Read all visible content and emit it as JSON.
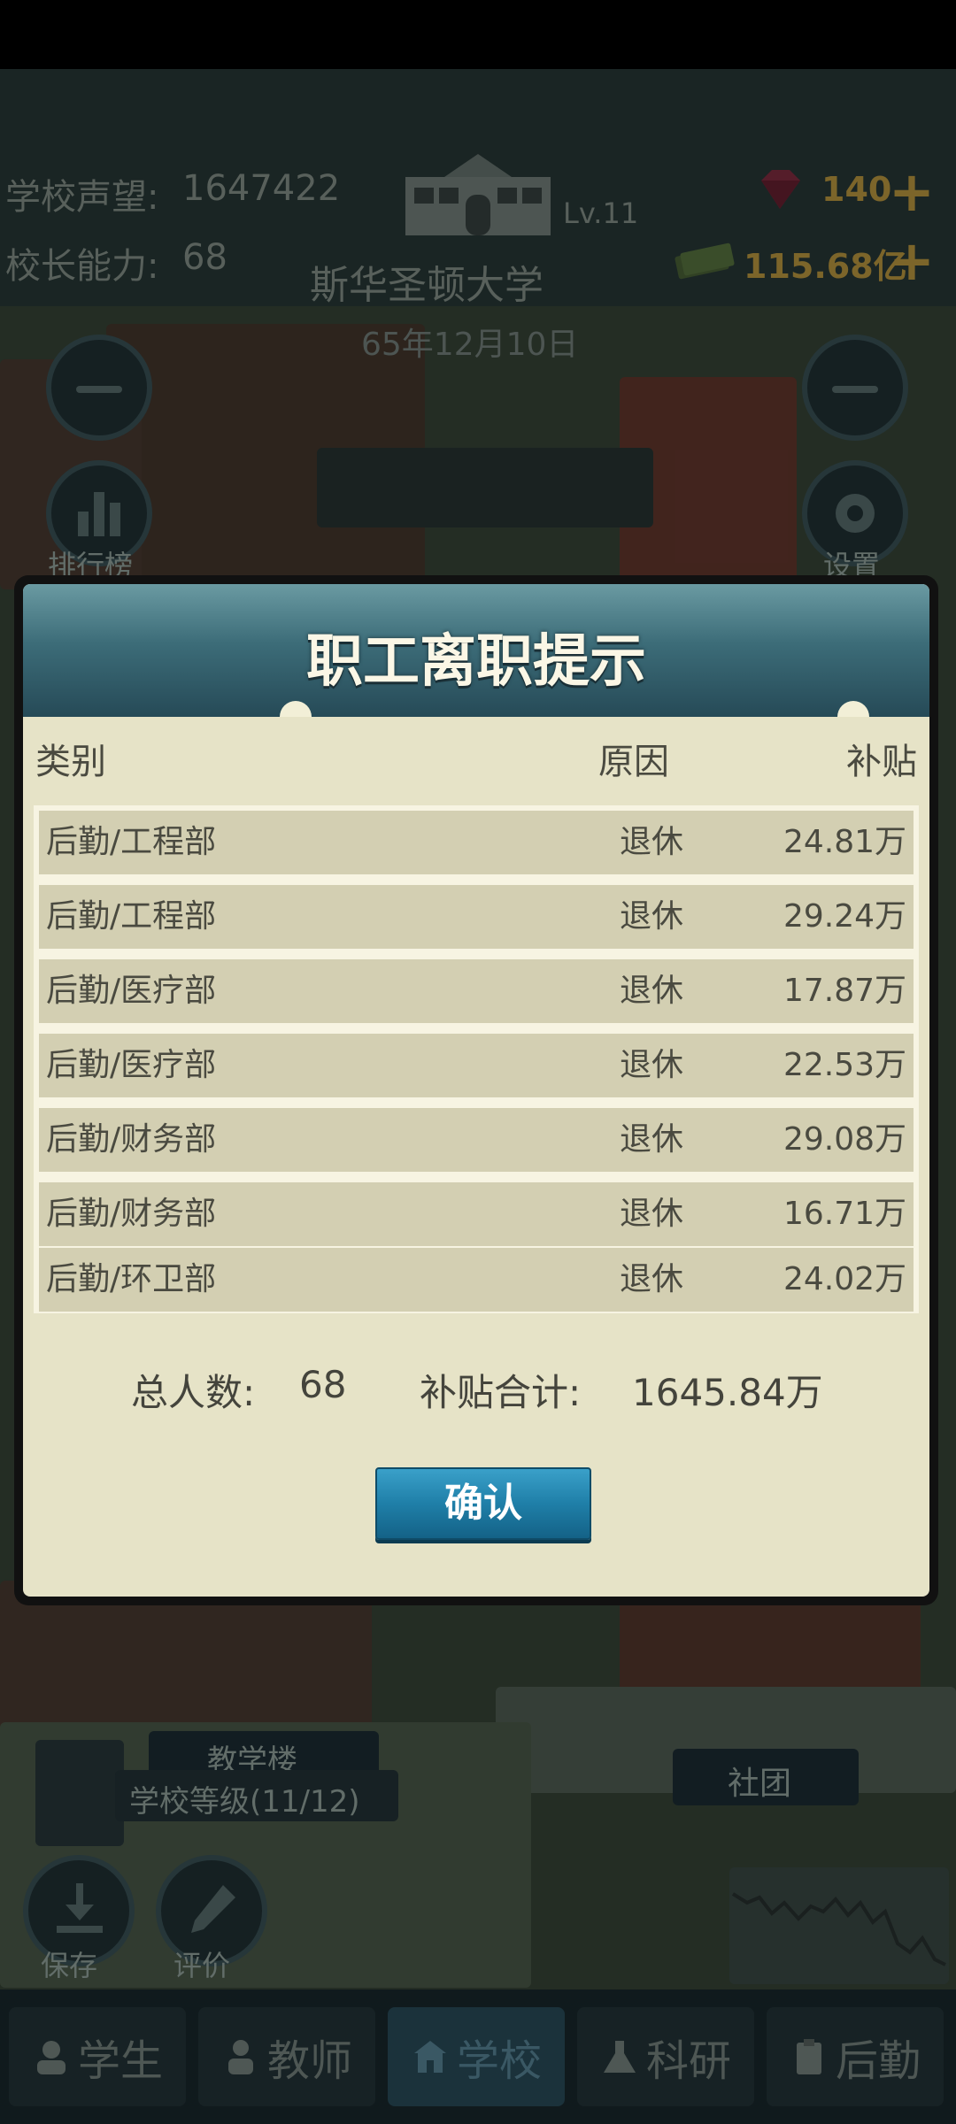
{
  "topbar": {
    "reputation_label": "学校声望:",
    "reputation_value": "1647422",
    "ability_label": "校长能力:",
    "ability_value": "68",
    "school_level": "Lv.11",
    "school_name": "斯华圣顿大学",
    "date": "65年12月10日",
    "gems": "140",
    "money": "115.68亿"
  },
  "side_buttons": {
    "ranking": "排行榜",
    "settings": "设置",
    "save": "保存",
    "review": "评价"
  },
  "map_labels": {
    "building": "教学楼",
    "school_grade": "学校等级(11/12)",
    "club": "社团"
  },
  "dialog": {
    "title": "职工离职提示",
    "headers": {
      "category": "类别",
      "reason": "原因",
      "subsidy": "补贴"
    },
    "rows": [
      {
        "category": "后勤/工程部",
        "reason": "退休",
        "subsidy": "24.81万"
      },
      {
        "category": "后勤/工程部",
        "reason": "退休",
        "subsidy": "29.24万"
      },
      {
        "category": "后勤/医疗部",
        "reason": "退休",
        "subsidy": "17.87万"
      },
      {
        "category": "后勤/医疗部",
        "reason": "退休",
        "subsidy": "22.53万"
      },
      {
        "category": "后勤/财务部",
        "reason": "退休",
        "subsidy": "29.08万"
      },
      {
        "category": "后勤/财务部",
        "reason": "退休",
        "subsidy": "16.71万"
      },
      {
        "category": "后勤/环卫部",
        "reason": "退休",
        "subsidy": "24.02万"
      }
    ],
    "summary": {
      "count_label": "总人数:",
      "count_value": "68",
      "total_label": "补贴合计:",
      "total_value": "1645.84万"
    },
    "confirm_label": "确认"
  },
  "bottom_nav": {
    "tabs": [
      {
        "label": "学生",
        "icon": "student-icon"
      },
      {
        "label": "教师",
        "icon": "teacher-icon"
      },
      {
        "label": "学校",
        "icon": "school-icon",
        "active": true
      },
      {
        "label": "科研",
        "icon": "flask-icon"
      },
      {
        "label": "后勤",
        "icon": "clipboard-icon"
      }
    ]
  },
  "colors": {
    "dialog_bg": "#e6e3c7",
    "row_bg": "#d3cfb2",
    "header_teal": "#3c6c78",
    "confirm_blue": "#1f7fa8",
    "gold": "#c9a445"
  }
}
